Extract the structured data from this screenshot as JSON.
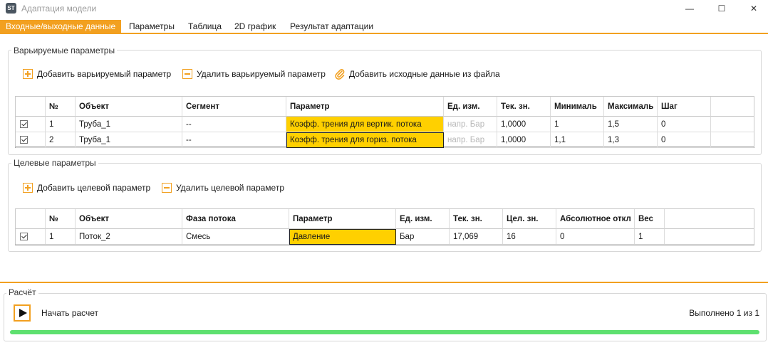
{
  "window": {
    "app_icon": "ST",
    "title": "Адаптация модели",
    "minimize": "—",
    "maximize": "☐",
    "close": "✕"
  },
  "tabs": [
    {
      "label": "Входные/выходные данные",
      "active": true
    },
    {
      "label": "Параметры",
      "active": false
    },
    {
      "label": "Таблица",
      "active": false
    },
    {
      "label": "2D график",
      "active": false
    },
    {
      "label": "Результат адаптации",
      "active": false
    }
  ],
  "variable_params": {
    "title": "Варьируемые параметры",
    "add_label": "Добавить варьируемый параметр",
    "remove_label": "Удалить варьируемый параметр",
    "import_label": "Добавить исходные данные из файла",
    "columns": [
      "",
      "№",
      "Объект",
      "Сегмент",
      "Параметр",
      "Ед. изм.",
      "Тек. зн.",
      "Минималь",
      "Максималь",
      "Шаг",
      ""
    ],
    "rows": [
      {
        "checked": true,
        "num": "1",
        "object": "Труба_1",
        "segment": "--",
        "param": "Коэфф. трения для вертик. потока",
        "unit": "напр. Бар",
        "current": "1,0000",
        "min": "1",
        "max": "1,5",
        "step": "0"
      },
      {
        "checked": true,
        "num": "2",
        "object": "Труба_1",
        "segment": "--",
        "param": "Коэфф. трения для гориз. потока",
        "unit": "напр. Бар",
        "current": "1,0000",
        "min": "1,1",
        "max": "1,3",
        "step": "0"
      }
    ]
  },
  "target_params": {
    "title": "Целевые параметры",
    "add_label": "Добавить целевой параметр",
    "remove_label": "Удалить целевой параметр",
    "columns": [
      "",
      "№",
      "Объект",
      "Фаза потока",
      "Параметр",
      "Ед. изм.",
      "Тек. зн.",
      "Цел. зн.",
      "Абсолютное откл",
      "Вес",
      ""
    ],
    "rows": [
      {
        "checked": true,
        "num": "1",
        "object": "Поток_2",
        "phase": "Смесь",
        "param": "Давление",
        "unit": "Бар",
        "current": "17,069",
        "target": "16",
        "abs_dev": "0",
        "weight": "1"
      }
    ]
  },
  "calculation": {
    "title": "Расчёт",
    "start_label": "Начать расчет",
    "status": "Выполнено 1 из 1",
    "progress": 1.0
  },
  "colors": {
    "accent": "#f2a020",
    "param_highlight": "#ffd000",
    "progress": "#5ee06f"
  }
}
